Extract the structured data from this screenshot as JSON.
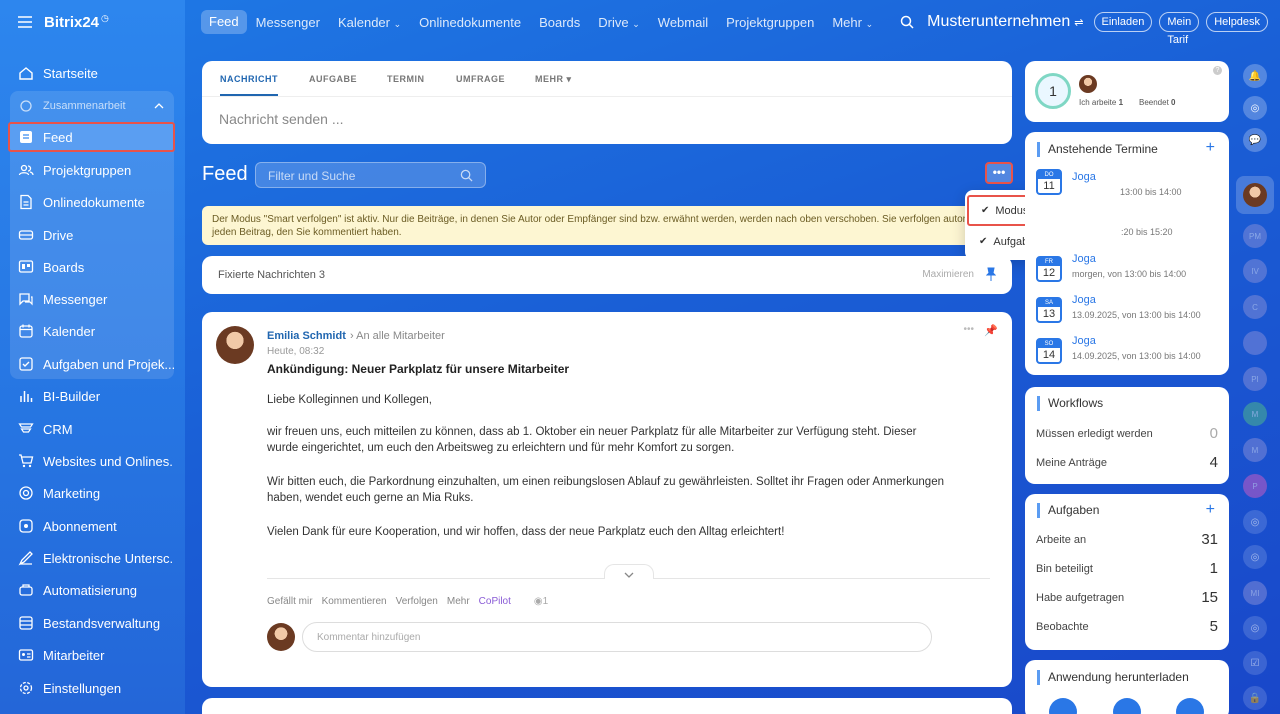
{
  "brand": "Bitrix24",
  "topnav": [
    "Feed",
    "Messenger",
    "Kalender",
    "Onlinedokumente",
    "Boards",
    "Drive",
    "Webmail",
    "Projektgruppen",
    "Mehr"
  ],
  "company": "Musterunternehmen",
  "top_buttons": [
    "Einladen",
    "Mein Tarif",
    "Helpdesk"
  ],
  "sidebar": {
    "items": [
      {
        "label": "Startseite",
        "icon": "home-icon"
      }
    ],
    "group_label": "Zusammenarbeit",
    "group_items": [
      {
        "label": "Feed",
        "icon": "feed-icon"
      },
      {
        "label": "Projektgruppen",
        "icon": "groups-icon"
      },
      {
        "label": "Onlinedokumente",
        "icon": "document-icon"
      },
      {
        "label": "Drive",
        "icon": "drive-icon"
      },
      {
        "label": "Boards",
        "icon": "boards-icon"
      },
      {
        "label": "Messenger",
        "icon": "messenger-icon"
      },
      {
        "label": "Kalender",
        "icon": "calendar-icon"
      },
      {
        "label": "Aufgaben und Projek...",
        "icon": "tasks-icon"
      }
    ],
    "bottom_items": [
      {
        "label": "BI-Builder",
        "icon": "bi-icon"
      },
      {
        "label": "CRM",
        "icon": "crm-icon"
      },
      {
        "label": "Websites und Onlines...",
        "icon": "cart-icon"
      },
      {
        "label": "Marketing",
        "icon": "marketing-icon"
      },
      {
        "label": "Abonnement",
        "icon": "subscription-icon"
      },
      {
        "label": "Elektronische Untersc...",
        "icon": "signature-icon"
      },
      {
        "label": "Automatisierung",
        "icon": "automation-icon"
      },
      {
        "label": "Bestandsverwaltung",
        "icon": "inventory-icon"
      },
      {
        "label": "Mitarbeiter",
        "icon": "employees-icon"
      },
      {
        "label": "Einstellungen",
        "icon": "settings-icon"
      }
    ]
  },
  "composer": {
    "tabs": [
      "NACHRICHT",
      "AUFGABE",
      "TERMIN",
      "UMFRAGE",
      "MEHR"
    ],
    "placeholder": "Nachricht senden ..."
  },
  "feed": {
    "title": "Feed",
    "filter_placeholder": "Filter und Suche",
    "more": "•••"
  },
  "dropdown": {
    "items": [
      "Modus \"Smart verfolgen\"",
      "Aufgaben ausblenden"
    ]
  },
  "notice": "Der Modus \"Smart verfolgen\" ist aktiv. Nur die Beiträge, in denen Sie Autor oder Empfänger sind bzw. erwähnt werden, werden nach oben verschoben. Sie verfolgen automatisch jeden Beitrag, den Sie kommentiert haben.",
  "pinned": {
    "label": "Fixierte Nachrichten 3",
    "maximize": "Maximieren"
  },
  "post": {
    "author": "Emilia Schmidt",
    "audience": "An alle Mitarbeiter",
    "time": "Heute, 08:32",
    "title": "Ankündigung: Neuer Parkplatz für unsere Mitarbeiter",
    "p1": "Liebe Kolleginnen und Kollegen,",
    "p2": "wir freuen uns, euch mitteilen zu können, dass ab 1. Oktober ein neuer Parkplatz für alle Mitarbeiter zur Verfügung steht. Dieser wurde eingerichtet, um euch den Arbeitsweg zu erleichtern und für mehr Komfort zu sorgen.",
    "p3": "Wir bitten euch, die Parkordnung einzuhalten, um einen reibungslosen Ablauf zu gewährleisten. Solltet ihr Fragen oder Anmerkungen haben, wendet euch gerne an Mia Ruks.",
    "p4": "Vielen Dank für eure Kooperation, und wir hoffen, dass der neue Parkplatz euch den Alltag erleichtert!",
    "actions": [
      "Gefällt mir",
      "Kommentieren",
      "Verfolgen",
      "Mehr",
      "CoPilot"
    ],
    "views": "1",
    "comment_placeholder": "Kommentar hinzufügen"
  },
  "worktime": {
    "count": "1",
    "working": "Ich arbeite",
    "working_n": "1",
    "done": "Beendet",
    "done_n": "0"
  },
  "events": {
    "title": "Anstehende Termine",
    "items": [
      {
        "day": "DO",
        "num": "11",
        "title": "Joga",
        "sub": "heute, von 13:00 bis 14:00"
      },
      {
        "day": "FR",
        "num": "12",
        "title": "Joga",
        "sub": "morgen, von 13:00 bis 14:00"
      },
      {
        "day": "SA",
        "num": "13",
        "title": "Joga",
        "sub": "13.09.2025, von 13:00 bis 14:00"
      },
      {
        "day": "SO",
        "num": "14",
        "title": "Joga",
        "sub": "14.09.2025, von 13:00 bis 14:00"
      }
    ],
    "overlap_time": ":20 bis 15:20",
    "overlap_time2": "13:00 bis 14:00"
  },
  "workflows": {
    "title": "Workflows",
    "rows": [
      {
        "label": "Müssen erledigt werden",
        "value": "0"
      },
      {
        "label": "Meine Anträge",
        "value": "4"
      }
    ]
  },
  "tasks": {
    "title": "Aufgaben",
    "rows": [
      {
        "label": "Arbeite an",
        "value": "31"
      },
      {
        "label": "Bin beteiligt",
        "value": "1"
      },
      {
        "label": "Habe aufgetragen",
        "value": "15"
      },
      {
        "label": "Beobachte",
        "value": "5"
      }
    ]
  },
  "download": {
    "title": "Anwendung herunterladen"
  },
  "rail": [
    "PM",
    "IV",
    "C",
    "PI",
    "M",
    "M",
    "P",
    "MI"
  ],
  "colors": {
    "accent": "#2a77e6",
    "highlight": "#e8534a",
    "notice": "#fdf6d2"
  }
}
